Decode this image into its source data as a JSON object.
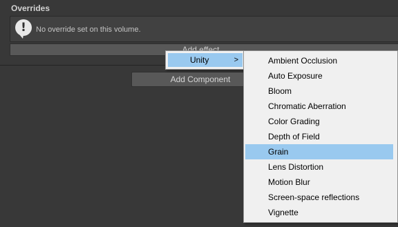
{
  "overrides": {
    "title": "Overrides",
    "info_message": "No override set on this volume.",
    "info_icon": "info-exclamation-icon"
  },
  "buttons": {
    "add_effect": "Add effect...",
    "add_component": "Add Component"
  },
  "menu": {
    "level1": {
      "label": "Unity",
      "arrow": ">"
    },
    "level2_items": [
      "Ambient Occlusion",
      "Auto Exposure",
      "Bloom",
      "Chromatic Aberration",
      "Color Grading",
      "Depth of Field",
      "Grain",
      "Lens Distortion",
      "Motion Blur",
      "Screen-space reflections",
      "Vignette"
    ],
    "highlighted_item": "Grain"
  },
  "colors": {
    "background": "#383838",
    "menu_background": "#f0f0f0",
    "menu_highlight": "#99c9ef"
  }
}
